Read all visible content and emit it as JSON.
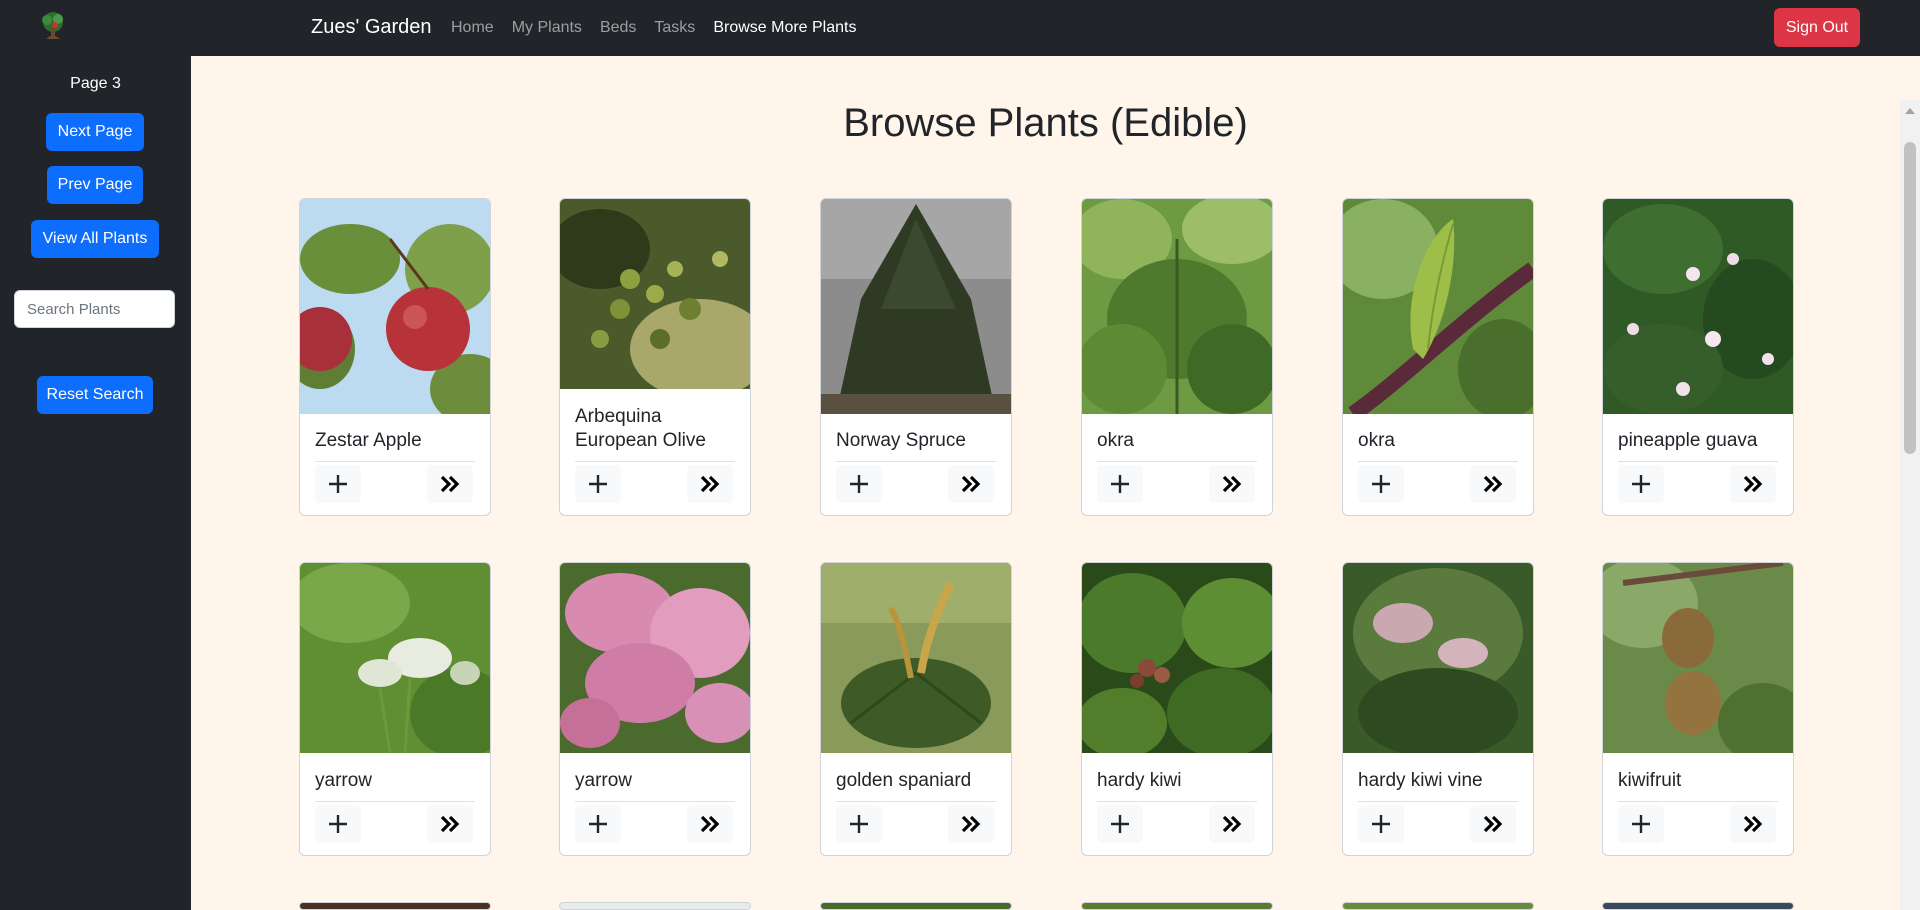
{
  "app": {
    "title": "Zues' Garden"
  },
  "nav": {
    "links": [
      {
        "label": "Home"
      },
      {
        "label": "My Plants"
      },
      {
        "label": "Beds"
      },
      {
        "label": "Tasks"
      },
      {
        "label": "Browse More Plants",
        "active": true
      }
    ],
    "signout_label": "Sign Out"
  },
  "sidebar": {
    "page_label": "Page 3",
    "next_label": "Next Page",
    "prev_label": "Prev Page",
    "view_all_label": "View All Plants",
    "search_placeholder": "Search Plants",
    "reset_label": "Reset Search"
  },
  "main": {
    "heading": "Browse Plants (Edible)",
    "plants": [
      {
        "name": "Zestar Apple",
        "image": "apple"
      },
      {
        "name": "Arbequina European Olive",
        "image": "olive"
      },
      {
        "name": "Norway Spruce",
        "image": "spruce"
      },
      {
        "name": "okra",
        "image": "okra-field"
      },
      {
        "name": "okra",
        "image": "okra-pod"
      },
      {
        "name": "pineapple guava",
        "image": "guava"
      },
      {
        "name": "yarrow",
        "image": "yarrow-white"
      },
      {
        "name": "yarrow",
        "image": "yarrow-pink"
      },
      {
        "name": "golden spaniard",
        "image": "spaniard"
      },
      {
        "name": "hardy kiwi",
        "image": "hardy-kiwi"
      },
      {
        "name": "hardy kiwi vine",
        "image": "hardy-kiwi-vine"
      },
      {
        "name": "kiwifruit",
        "image": "kiwifruit"
      }
    ]
  },
  "colors": {
    "navbar": "#212529",
    "page_bg": "#fff5eb",
    "primary": "#0d6efd",
    "danger": "#dc3545"
  },
  "icons": {
    "add": "plus-icon",
    "details": "double-chevron-right-icon"
  }
}
